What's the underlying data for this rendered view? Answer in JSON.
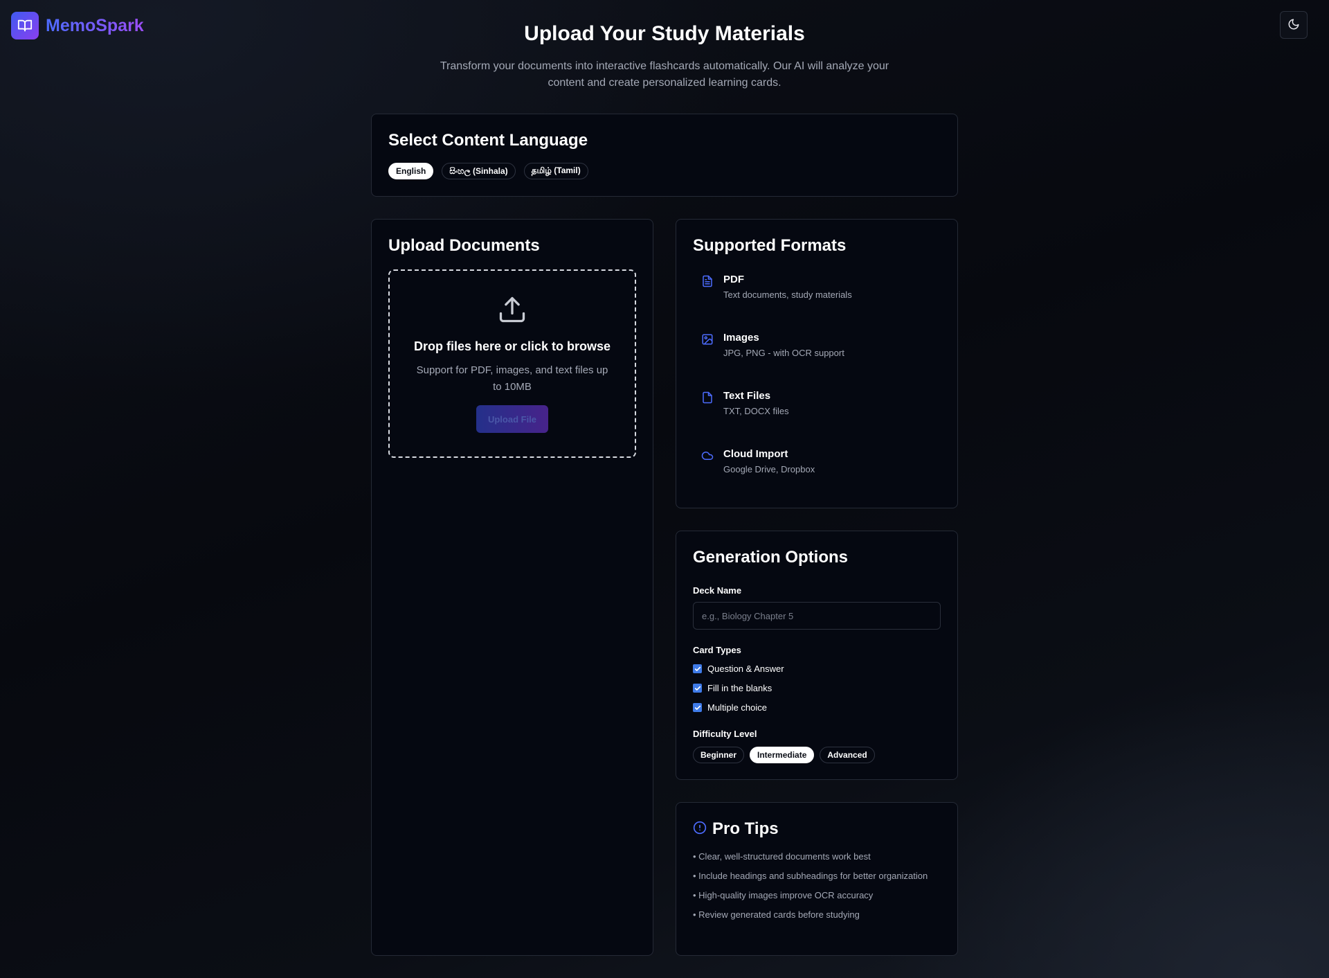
{
  "app": {
    "name": "MemoSpark",
    "theme_toggle_icon": "moon-icon"
  },
  "header": {
    "title": "Upload Your Study Materials",
    "subtitle": "Transform your documents into interactive flashcards automatically. Our AI will analyze your content and create personalized learning cards."
  },
  "language": {
    "title": "Select Content Language",
    "options": [
      "English",
      "සිංහල (Sinhala)",
      "தமிழ் (Tamil)"
    ],
    "selected": "English"
  },
  "upload": {
    "title": "Upload Documents",
    "drop_title": "Drop files here or click to browse",
    "drop_sub": "Support for PDF, images, and text files up to 10MB",
    "button": "Upload File"
  },
  "formats": {
    "title": "Supported Formats",
    "items": [
      {
        "icon": "file-text-icon",
        "name": "PDF",
        "desc": "Text documents, study materials"
      },
      {
        "icon": "image-icon",
        "name": "Images",
        "desc": "JPG, PNG - with OCR support"
      },
      {
        "icon": "file-icon",
        "name": "Text Files",
        "desc": "TXT, DOCX files"
      },
      {
        "icon": "cloud-icon",
        "name": "Cloud Import",
        "desc": "Google Drive, Dropbox"
      }
    ]
  },
  "generation": {
    "title": "Generation Options",
    "deck_label": "Deck Name",
    "deck_placeholder": "e.g., Biology Chapter 5",
    "deck_value": "",
    "card_types_label": "Card Types",
    "card_types": [
      {
        "label": "Question & Answer",
        "checked": true
      },
      {
        "label": "Fill in the blanks",
        "checked": true
      },
      {
        "label": "Multiple choice",
        "checked": true
      }
    ],
    "difficulty_label": "Difficulty Level",
    "difficulty": [
      "Beginner",
      "Intermediate",
      "Advanced"
    ],
    "difficulty_selected": "Intermediate"
  },
  "tips": {
    "title": "Pro Tips",
    "items": [
      "• Clear, well-structured documents work best",
      "• Include headings and subheadings for better organization",
      "• High-quality images improve OCR accuracy",
      "• Review generated cards before studying"
    ]
  },
  "colors": {
    "accent": "#4d6cff",
    "accent2": "#9b4df5",
    "checkbox": "#3f7be8"
  }
}
